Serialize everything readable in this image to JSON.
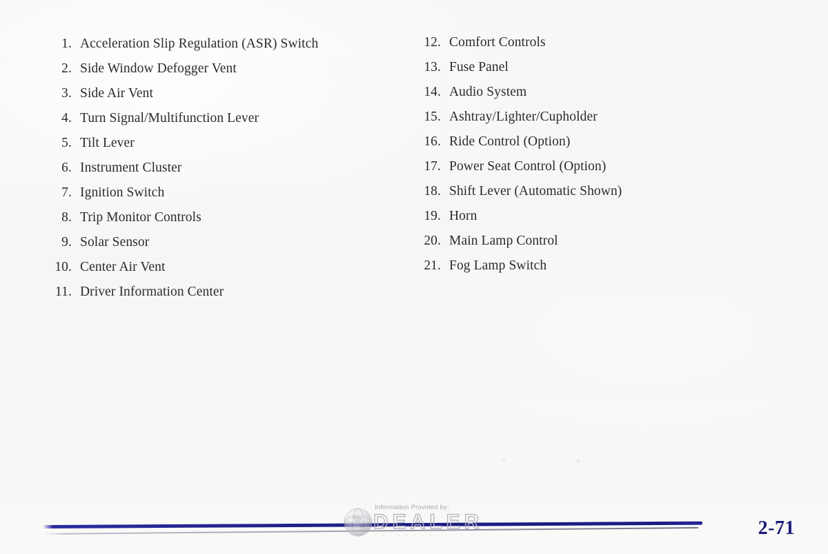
{
  "page": {
    "background_color": "#f7f7f5",
    "text_color": "#2b2b2b",
    "accent_color": "#1b1b7a",
    "page_number": "2-71"
  },
  "columns": {
    "left": [
      {
        "number": "1.",
        "label": "Acceleration Slip Regulation (ASR) Switch"
      },
      {
        "number": "2.",
        "label": "Side Window Defogger Vent"
      },
      {
        "number": "3.",
        "label": "Side Air Vent"
      },
      {
        "number": "4.",
        "label": "Turn Signal/Multifunction Lever"
      },
      {
        "number": "5.",
        "label": "Tilt Lever"
      },
      {
        "number": "6.",
        "label": "Instrument Cluster"
      },
      {
        "number": "7.",
        "label": "Ignition Switch"
      },
      {
        "number": "8.",
        "label": "Trip Monitor Controls"
      },
      {
        "number": "9.",
        "label": "Solar Sensor"
      },
      {
        "number": "10.",
        "label": "Center Air Vent"
      },
      {
        "number": "11.",
        "label": "Driver Information Center"
      }
    ],
    "right": [
      {
        "number": "12.",
        "label": "Comfort Controls"
      },
      {
        "number": "13.",
        "label": "Fuse Panel"
      },
      {
        "number": "14.",
        "label": "Audio System"
      },
      {
        "number": "15.",
        "label": "Ashtray/Lighter/Cupholder"
      },
      {
        "number": "16.",
        "label": "Ride Control (Option)"
      },
      {
        "number": "17.",
        "label": "Power Seat Control (Option)"
      },
      {
        "number": "18.",
        "label": "Shift Lever (Automatic Shown)"
      },
      {
        "number": "19.",
        "label": "Horn"
      },
      {
        "number": "20.",
        "label": "Main Lamp Control"
      },
      {
        "number": "21.",
        "label": "Fog Lamp Switch"
      }
    ]
  },
  "watermark": {
    "provided_by": "Information Provided by:",
    "brand": "DEALER",
    "sub": "- - - - - - - - - - - -",
    "icon": "globe-icon",
    "color": "#b6b8bf"
  }
}
